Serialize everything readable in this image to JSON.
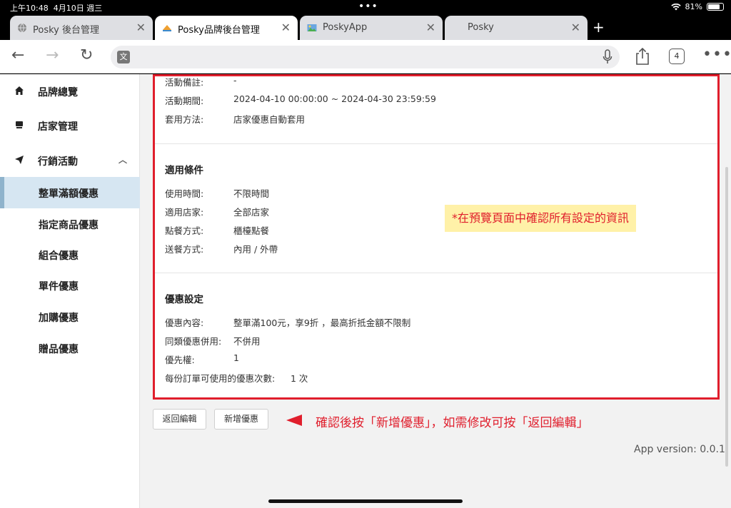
{
  "status": {
    "time": "上午10:48",
    "date": "4月10日 週三",
    "battery_text": "81%",
    "battery_level": 0.81
  },
  "browser": {
    "tabs": [
      {
        "label": "Posky 後台管理",
        "active": false
      },
      {
        "label": "Posky品牌後台管理",
        "active": true
      },
      {
        "label": "PoskyApp",
        "active": false
      },
      {
        "label": "Posky",
        "active": false
      }
    ],
    "new_tab": "+",
    "url_value": "",
    "tab_count": "4"
  },
  "sidebar": {
    "menus": [
      {
        "label": "品牌總覽",
        "icon": "home-icon"
      },
      {
        "label": "店家管理",
        "icon": "store-icon"
      },
      {
        "label": "行銷活動",
        "icon": "send-icon",
        "expanded": true
      }
    ],
    "sub_items": [
      "整單滿額優惠",
      "指定商品優惠",
      "組合優惠",
      "單件優惠",
      "加購優惠",
      "贈品優惠"
    ],
    "active_sub": "整單滿額優惠"
  },
  "preview": {
    "basic": [
      {
        "key": "活動備註:",
        "value": "-"
      },
      {
        "key": "活動期間:",
        "value": "2024-04-10 00:00:00 ~ 2024-04-30 23:59:59"
      },
      {
        "key": "套用方法:",
        "value": "店家優惠自動套用"
      }
    ],
    "conditions_title": "適用條件",
    "conditions": [
      {
        "key": "使用時間:",
        "value": "不限時間"
      },
      {
        "key": "適用店家:",
        "value": "全部店家"
      },
      {
        "key": "點餐方式:",
        "value": "櫃檯點餐"
      },
      {
        "key": "送餐方式:",
        "value": "內用 / 外帶"
      }
    ],
    "discount_title": "優惠設定",
    "discount": [
      {
        "key": "優惠內容:",
        "value": "整單滿100元，享9折 ，最高折抵金額不限制"
      },
      {
        "key": "同類優惠併用:",
        "value": "不併用"
      },
      {
        "key": "優先權:",
        "value": "1"
      },
      {
        "key": "每份訂單可使用的優惠次數:",
        "value": "1 次"
      }
    ]
  },
  "annotations": {
    "note": "*在預覽頁面中確認所有設定的資訊",
    "instruction": "確認後按「新增優惠」，如需修改可按「返回編輯」"
  },
  "actions": {
    "back_label": "返回編輯",
    "add_label": "新增優惠"
  },
  "footer": {
    "version": "App version: 0.0.1"
  },
  "colors": {
    "highlight_red": "#e01e2c",
    "note_bg": "#fff1a8",
    "active_sidebar": "#d6e6f2"
  }
}
